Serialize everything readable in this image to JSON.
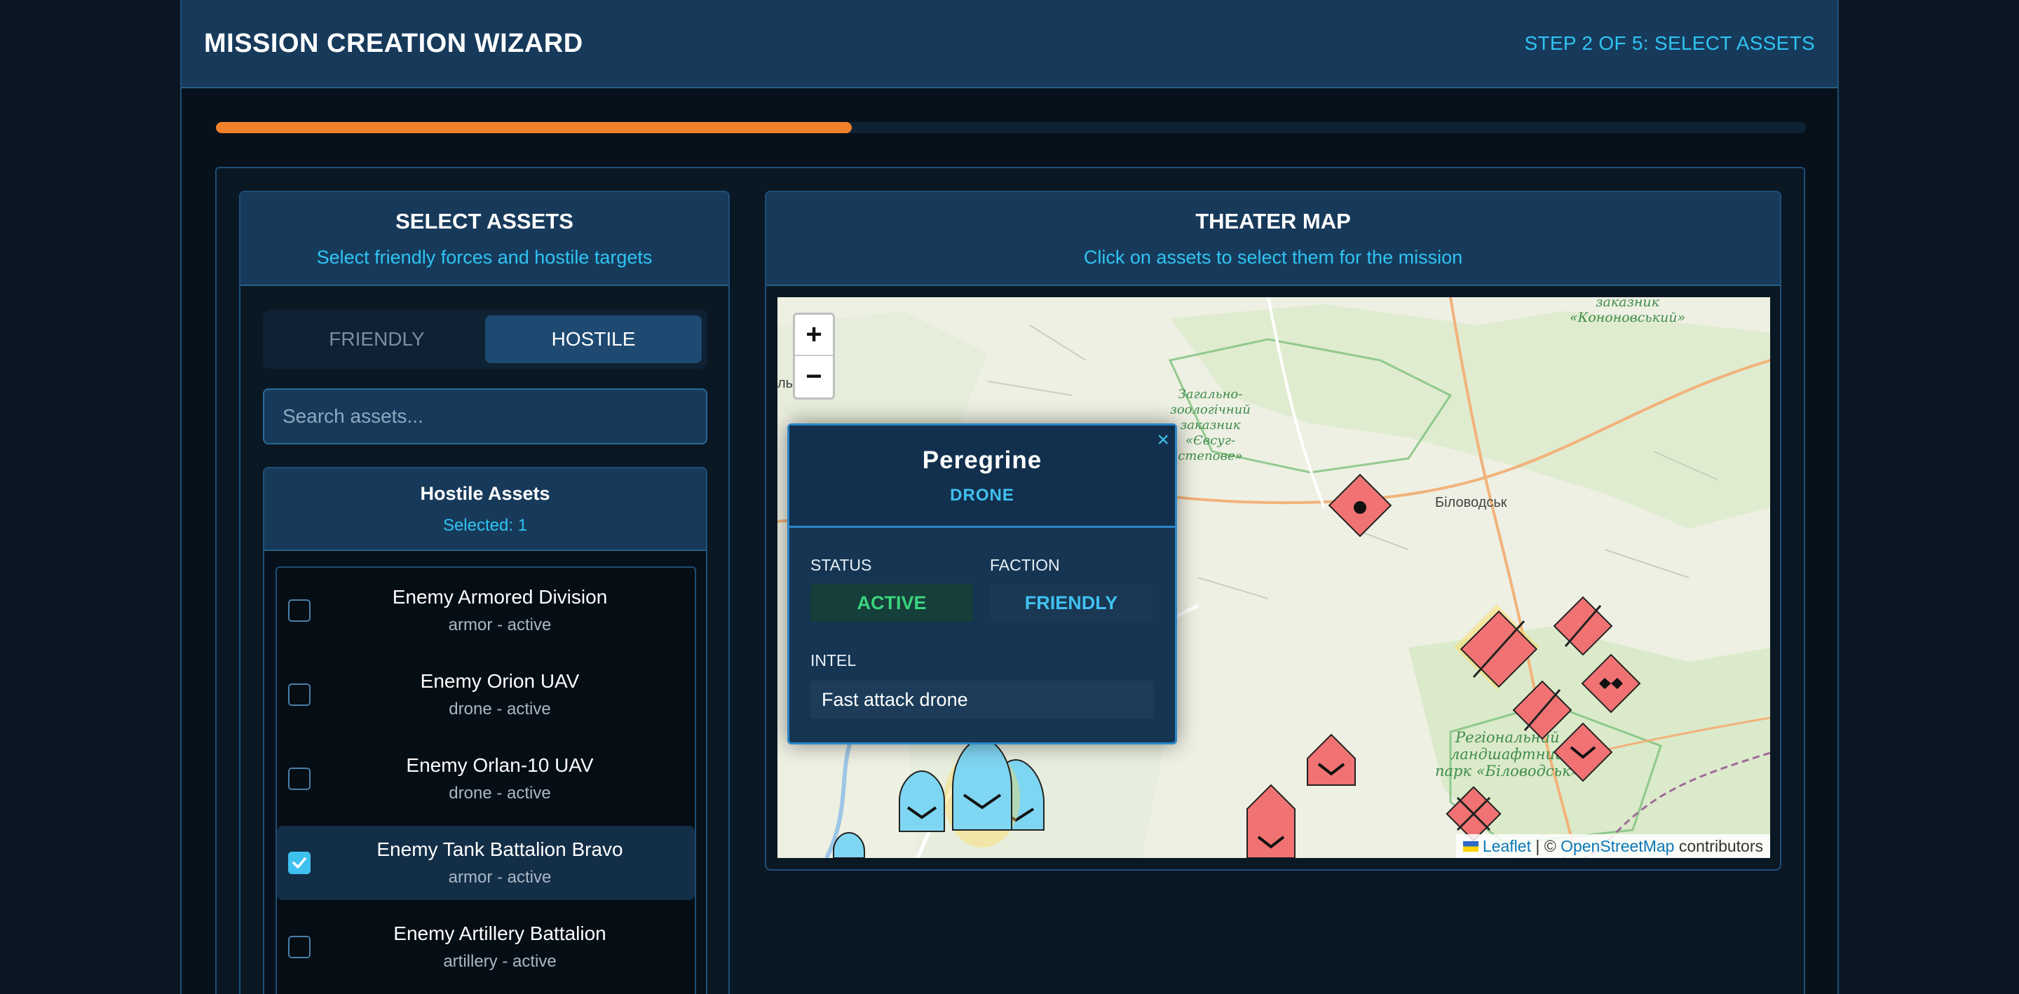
{
  "header": {
    "title": "MISSION CREATION WIZARD",
    "step": "STEP 2 OF 5: SELECT ASSETS"
  },
  "progress": {
    "percent": 40,
    "color": "#f0802a"
  },
  "assets_panel": {
    "title": "SELECT ASSETS",
    "subtitle": "Select friendly forces and hostile targets",
    "tabs": [
      {
        "label": "FRIENDLY",
        "active": false
      },
      {
        "label": "HOSTILE",
        "active": true
      }
    ],
    "search_placeholder": "Search assets...",
    "list_title": "Hostile Assets",
    "selected_text": "Selected: 1",
    "items": [
      {
        "name": "Enemy Armored Division",
        "meta": "armor - active",
        "checked": false
      },
      {
        "name": "Enemy Orion UAV",
        "meta": "drone - active",
        "checked": false
      },
      {
        "name": "Enemy Orlan-10 UAV",
        "meta": "drone - active",
        "checked": false
      },
      {
        "name": "Enemy Tank Battalion Bravo",
        "meta": "armor - active",
        "checked": true
      },
      {
        "name": "Enemy Artillery Battalion",
        "meta": "artillery - active",
        "checked": false
      }
    ]
  },
  "map_panel": {
    "title": "THEATER MAP",
    "subtitle": "Click on assets to select them for the mission",
    "zoom_in": "+",
    "zoom_out": "−",
    "attribution": {
      "leaflet": "Leaflet",
      "separator": " | © ",
      "osm": "OpenStreetMap",
      "suffix": " contributors"
    },
    "labels": {
      "reserve_1": "Загально-\nзоологічний\nзаказник\n«Євсуг-\nстепове»",
      "reserve_2": "заказник\n«Кононовський»",
      "town": "Біловодськ",
      "park": "Регіональний\nландшафтний\nпарк «Біловодськ»",
      "edge_fragment": "ль"
    },
    "popup": {
      "title": "Peregrine",
      "type": "DRONE",
      "status_label": "STATUS",
      "status_value": "ACTIVE",
      "faction_label": "FACTION",
      "faction_value": "FRIENDLY",
      "intel_label": "INTEL",
      "intel_value": "Fast attack drone",
      "close": "×"
    },
    "colors": {
      "hostile": "#f07272",
      "friendly": "#7fd6f2",
      "highlight": "#ffd95a"
    }
  }
}
